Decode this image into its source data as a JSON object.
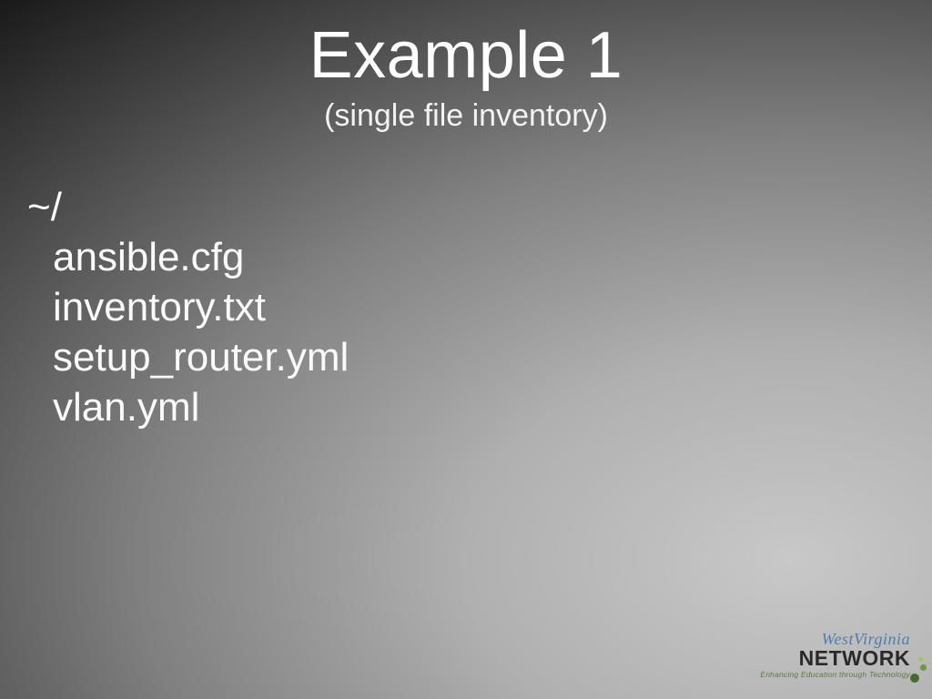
{
  "title": "Example 1",
  "subtitle": "(single file inventory)",
  "fs": {
    "root": "~/",
    "files": [
      "ansible.cfg",
      "inventory.txt",
      "setup_router.yml",
      "vlan.yml"
    ]
  },
  "logo": {
    "line1": "WestVirginia",
    "line2": "NETWORK",
    "tagline": "Enhancing Education through Technology"
  }
}
